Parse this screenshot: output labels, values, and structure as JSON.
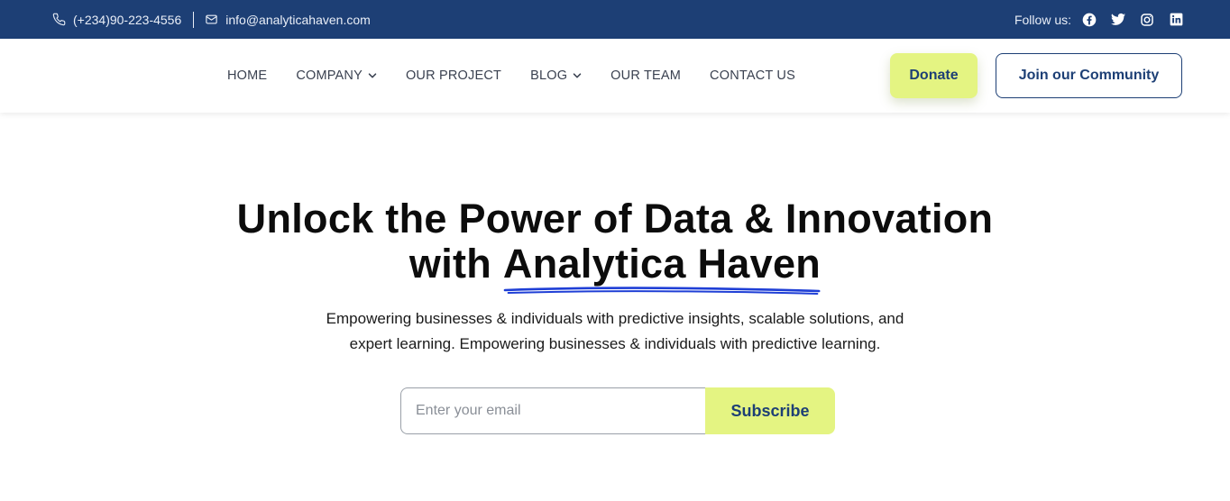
{
  "topbar": {
    "phone": "(+234)90-223-4556",
    "email": "info@analyticahaven.com",
    "follow_label": "Follow us:",
    "social": [
      "facebook-icon",
      "twitter-icon",
      "instagram-icon",
      "linkedin-icon"
    ]
  },
  "nav": {
    "items": [
      {
        "label": "HOME",
        "has_dropdown": false
      },
      {
        "label": "COMPANY",
        "has_dropdown": true
      },
      {
        "label": "OUR PROJECT",
        "has_dropdown": false
      },
      {
        "label": "BLOG",
        "has_dropdown": true
      },
      {
        "label": "OUR TEAM",
        "has_dropdown": false
      },
      {
        "label": "CONTACT US",
        "has_dropdown": false
      }
    ],
    "donate_label": "Donate",
    "community_label": "Join our Community"
  },
  "hero": {
    "title_line1": "Unlock the Power of Data & Innovation",
    "title_line2_prefix": "with ",
    "title_line2_highlight": "Analytica Haven",
    "subtitle_line1": "Empowering businesses & individuals with predictive insights, scalable solutions, and",
    "subtitle_line2": "expert learning. Empowering businesses & individuals with predictive learning."
  },
  "subscribe": {
    "placeholder": "Enter your email",
    "value": "",
    "button_label": "Subscribe"
  },
  "colors": {
    "primary": "#1d3f75",
    "accent": "#e4f482",
    "underline": "#1f3fd6"
  }
}
